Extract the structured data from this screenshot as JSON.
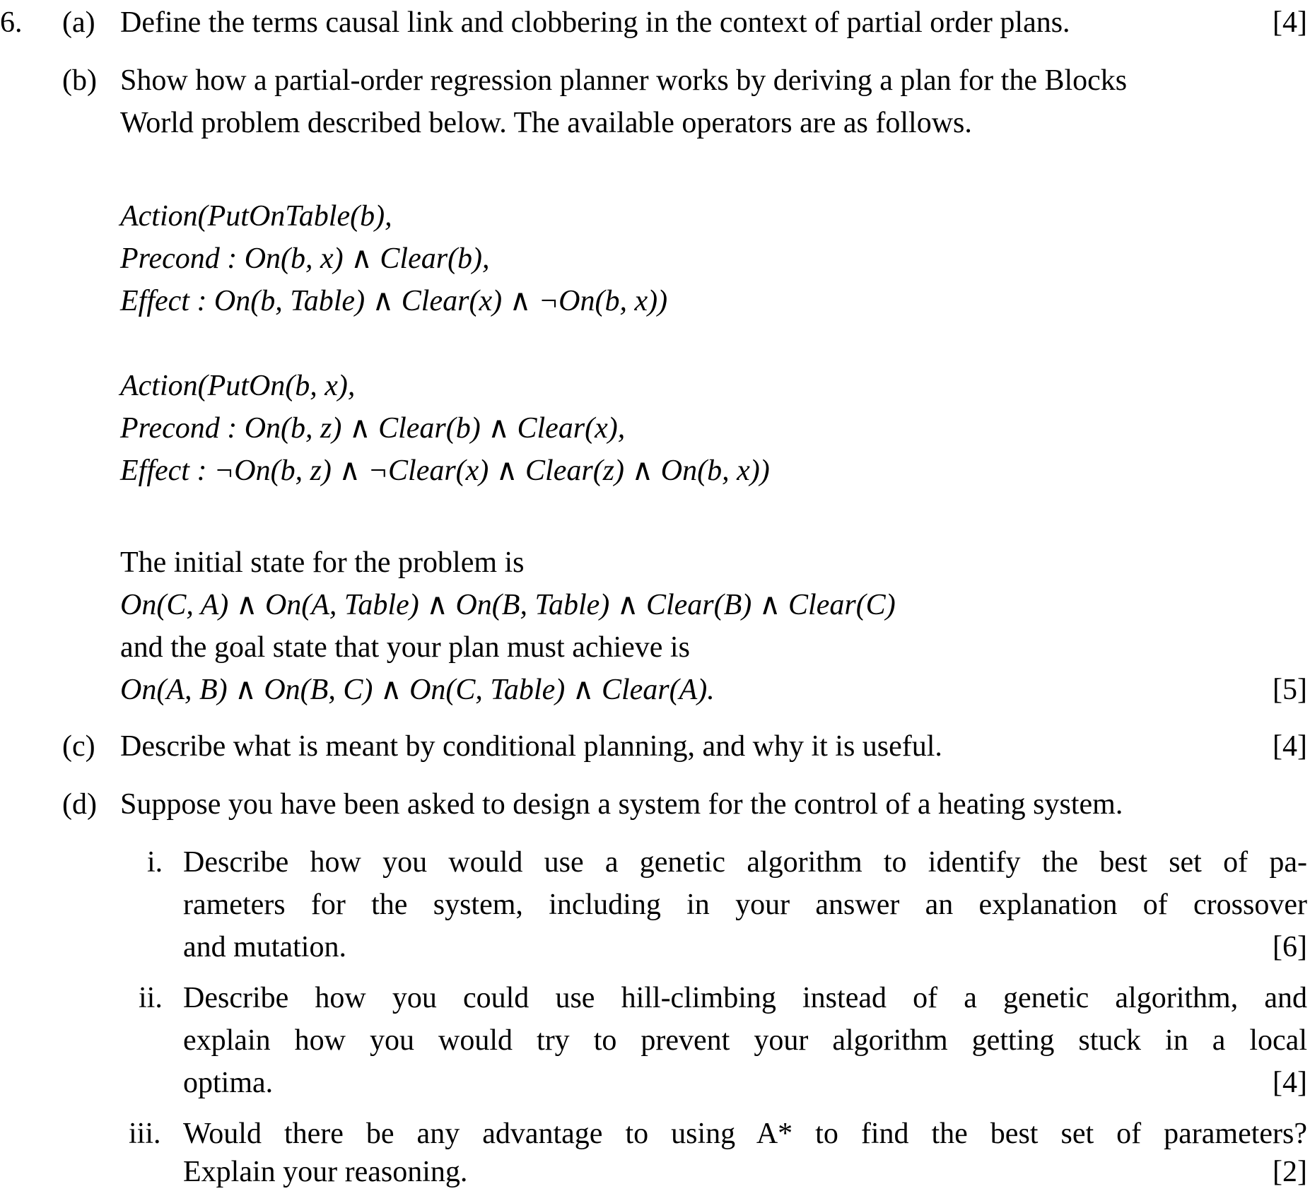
{
  "question": {
    "number": "6.",
    "a": {
      "label": "(a)",
      "text": "Define the terms causal link and clobbering in the context of partial order plans.",
      "marks": "[4]"
    },
    "b": {
      "label": "(b)",
      "text_line1": "Show how a partial-order regression planner works by deriving a plan for the Blocks",
      "text_line2": "World problem described below. The available operators are as follows.",
      "op1": {
        "action": "Action(PutOnTable(b),",
        "precond": "Precond : On(b, x) ∧ Clear(b),",
        "effect": "Effect : On(b, Table) ∧ Clear(x) ∧ ¬On(b, x))"
      },
      "op2": {
        "action": "Action(PutOn(b, x),",
        "precond": "Precond : On(b, z) ∧ Clear(b) ∧ Clear(x),",
        "effect": "Effect : ¬On(b, z) ∧ ¬Clear(x) ∧ Clear(z) ∧ On(b, x))"
      },
      "initial_intro": "The initial state for the problem is",
      "initial_state": "On(C, A) ∧ On(A, Table) ∧ On(B, Table) ∧ Clear(B) ∧ Clear(C)",
      "goal_intro": "and the goal state that your plan must achieve is",
      "goal_state": "On(A, B) ∧ On(B, C) ∧ On(C, Table) ∧ Clear(A).",
      "marks": "[5]"
    },
    "c": {
      "label": "(c)",
      "text": "Describe what is meant by conditional planning, and why it is useful.",
      "marks": "[4]"
    },
    "d": {
      "label": "(d)",
      "text": "Suppose you have been asked to design a system for the control of a heating system.",
      "i": {
        "label": "i.",
        "line1": "Describe how you would use a genetic algorithm to identify the best set of pa-",
        "line2": "rameters for the system, including in your answer an explanation of crossover",
        "line3": "and mutation.",
        "marks": "[6]"
      },
      "ii": {
        "label": "ii.",
        "line1": "Describe how you could use hill-climbing instead of a genetic algorithm, and",
        "line2": "explain how you would try to prevent your algorithm getting stuck in a local",
        "line3": "optima.",
        "marks": "[4]"
      },
      "iii": {
        "label": "iii.",
        "line1": "Would there be any advantage to using A* to find the best set of parameters?",
        "line2": "Explain your reasoning.",
        "marks": "[2]"
      }
    }
  }
}
